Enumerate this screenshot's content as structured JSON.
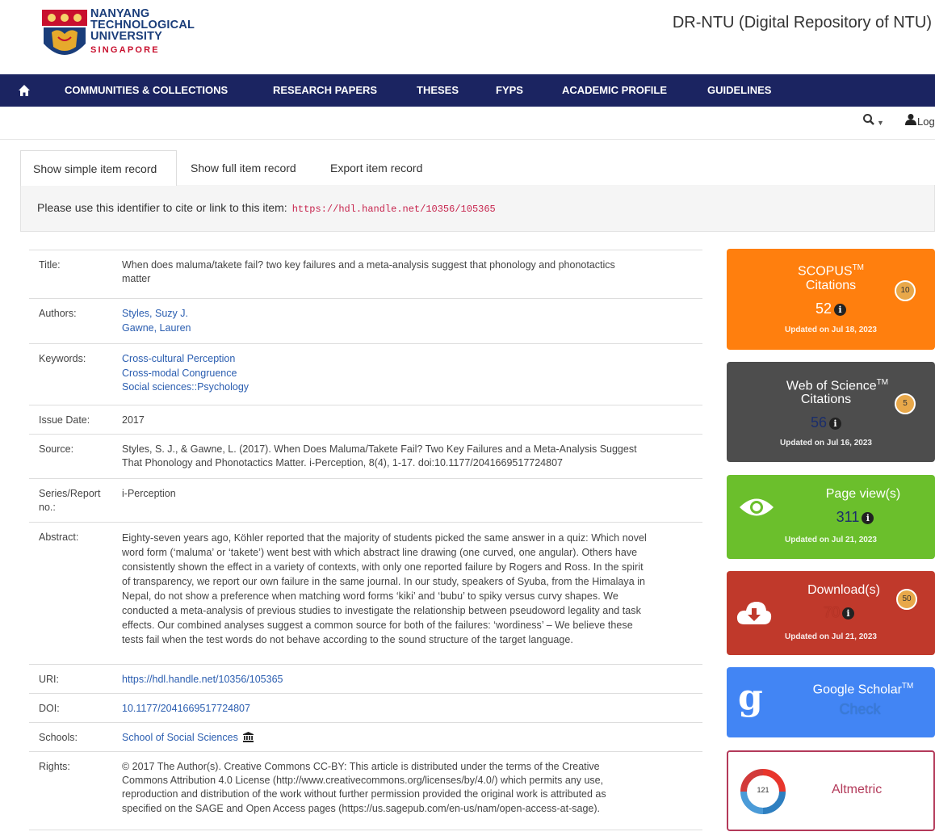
{
  "header": {
    "logo_lines": [
      "NANYANG",
      "TECHNOLOGICAL",
      "UNIVERSITY"
    ],
    "logo_country": "SINGAPORE",
    "site_title": "DR-NTU (Digital Repository of NTU)"
  },
  "nav": {
    "items": [
      "COMMUNITIES & COLLECTIONS",
      "RESEARCH PAPERS",
      "THESES",
      "FYPS",
      "ACADEMIC PROFILE",
      "GUIDELINES"
    ]
  },
  "util": {
    "login_label": "Log"
  },
  "tabs": [
    "Show simple item record",
    "Show full item record",
    "Export item record"
  ],
  "citation": {
    "text": "Please use this identifier to cite or link to this item:",
    "link": "https://hdl.handle.net/10356/105365"
  },
  "record": {
    "title_label": "Title:",
    "title_lines": [
      "When does maluma/takete fail? two key failures and a meta-analysis suggest that phonology and phonotactics",
      "matter"
    ],
    "authors_label": "Authors:",
    "authors": [
      "Styles, Suzy J.",
      "Gawne, Lauren"
    ],
    "keywords_label": "Keywords:",
    "keywords": [
      "Cross-cultural Perception",
      "Cross-modal Congruence",
      "Social sciences::Psychology"
    ],
    "issue_label": "Issue Date:",
    "issue_date": "2017",
    "source_label": "Source:",
    "source_lines": [
      "Styles, S. J., & Gawne, L. (2017). When Does Maluma/Takete Fail? Two Key Failures and a Meta-Analysis Suggest",
      "That Phonology and Phonotactics Matter. i-Perception, 8(4), 1-17. doi:10.1177/2041669517724807"
    ],
    "series_label_lines": [
      "Series/Report",
      "no.:"
    ],
    "series": "i-Perception",
    "abstract_label": "Abstract:",
    "abstract_lines": [
      "Eighty-seven years ago, Köhler reported that the majority of students picked the same answer in a quiz: Which novel",
      "word form (‘maluma’ or ‘takete’) went best with which abstract line drawing (one curved, one angular). Others have",
      "consistently shown the effect in a variety of contexts, with only one reported failure by Rogers and Ross. In the spirit",
      "of transparency, we report our own failure in the same journal. In our study, speakers of Syuba, from the Himalaya in",
      "Nepal, do not show a preference when matching word forms ‘kiki’ and ‘bubu’ to spiky versus curvy shapes. We",
      "conducted a meta-analysis of previous studies to investigate the relationship between pseudoword legality and task",
      "effects. Our combined analyses suggest a common source for both of the failures: ‘wordiness’ – We believe these",
      "tests fail when the test words do not behave according to the sound structure of the target language."
    ],
    "uri_label": "URI:",
    "uri": "https://hdl.handle.net/10356/105365",
    "doi_label": "DOI:",
    "doi": "10.1177/2041669517724807",
    "schools_label": "Schools:",
    "schools": "School of Social Sciences",
    "rights_label": "Rights:",
    "rights_lines": [
      "© 2017 The Author(s). Creative Commons CC-BY: This article is distributed under the terms of the Creative",
      "Commons Attribution 4.0 License (http://www.creativecommons.org/licenses/by/4.0/) which permits any use,",
      "reproduction and distribution of the work without further permission provided the original work is attributed as",
      "specified on the SAGE and Open Access pages (https://us.sagepub.com/en-us/nam/open-access-at-sage)."
    ]
  },
  "widgets": {
    "scopus": {
      "title_a": "SCOPUS",
      "title_b": "Citations",
      "tm": "TM",
      "count": "52",
      "updated": "Updated on Jul 18, 2023",
      "badge": "10",
      "color": "#ff7f0e"
    },
    "wos": {
      "title_a": "Web of Science",
      "title_b": "Citations",
      "tm": "TM",
      "count": "56",
      "updated": "Updated on Jul 16, 2023",
      "badge": "5",
      "color": "#4d4d4d"
    },
    "pageviews": {
      "title": "Page view(s)",
      "count": "311",
      "updated": "Updated on Jul 21, 2023",
      "color": "#6bbf2c"
    },
    "downloads": {
      "title": "Download(s)",
      "count": "70",
      "updated": "Updated on Jul 21, 2023",
      "badge": "50",
      "color": "#c0392b"
    },
    "scholar": {
      "title": "Google Scholar",
      "tm": "TM",
      "check": "Check",
      "color": "#4285f4"
    },
    "altmetric": {
      "label": "Altmetric",
      "score": "121"
    }
  }
}
